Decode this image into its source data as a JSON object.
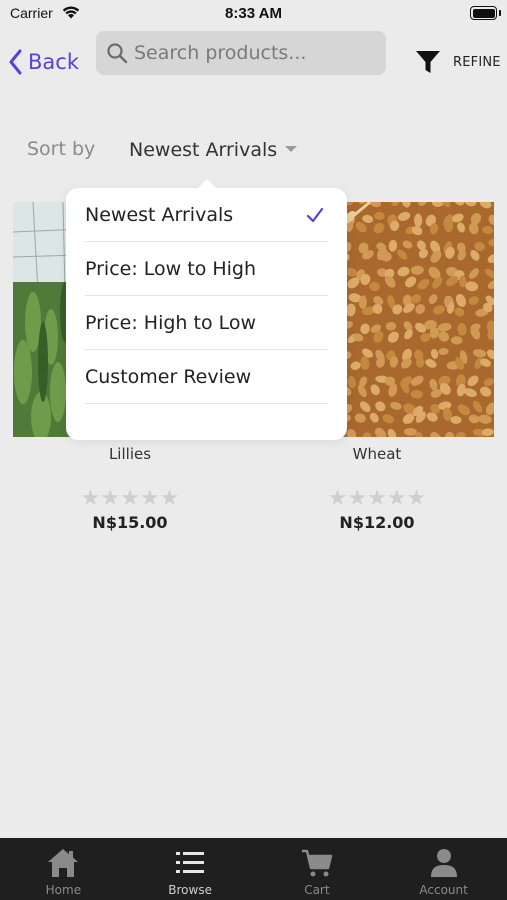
{
  "status_bar": {
    "carrier": "Carrier",
    "time": "8:33 AM"
  },
  "header": {
    "back_label": "Back",
    "search_placeholder": "Search products...",
    "refine_label": "REFINE"
  },
  "sort": {
    "label": "Sort by",
    "selected": "Newest Arrivals",
    "options": [
      "Newest Arrivals",
      "Price: Low to High",
      "Price: High to Low",
      "Customer Review"
    ]
  },
  "products": [
    {
      "name": "Lillies",
      "price": "N$15.00",
      "rating": 0
    },
    {
      "name": "Wheat",
      "price": "N$12.00",
      "rating": 0
    }
  ],
  "tabs": [
    {
      "label": "Home",
      "icon": "home-icon"
    },
    {
      "label": "Browse",
      "icon": "list-icon"
    },
    {
      "label": "Cart",
      "icon": "cart-icon"
    },
    {
      "label": "Account",
      "icon": "user-icon"
    }
  ],
  "colors": {
    "accent": "#5b3fd6",
    "background": "#ebebeb",
    "tab_bar": "#1f1f1f"
  }
}
